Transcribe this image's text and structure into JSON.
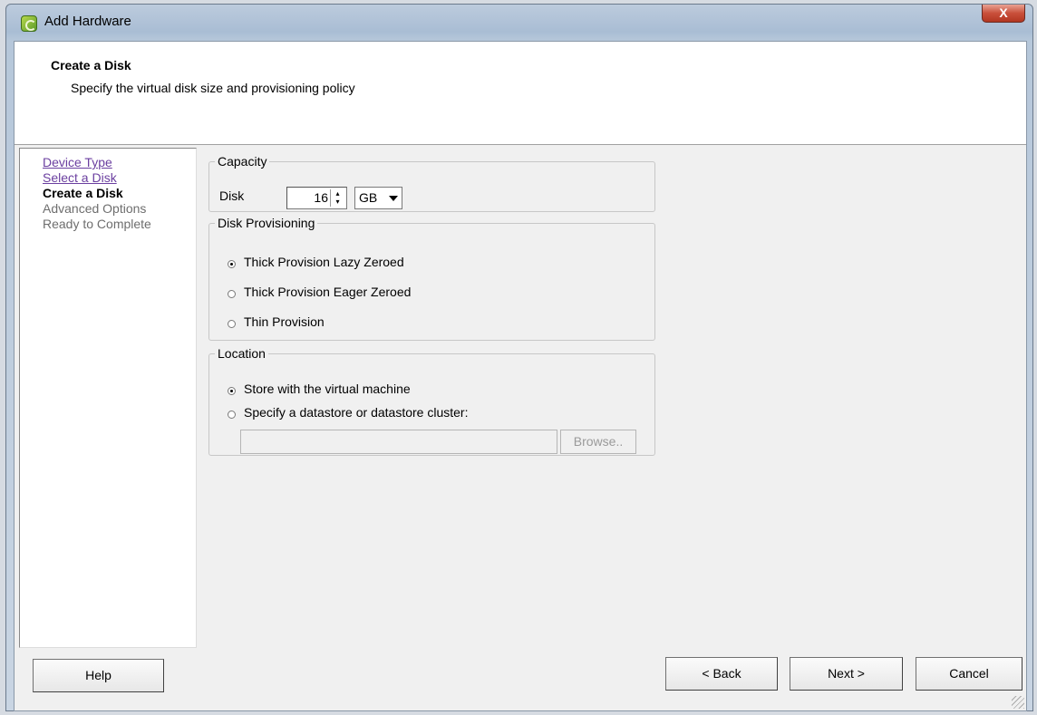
{
  "window": {
    "title": "Add Hardware",
    "close_label": "X"
  },
  "header": {
    "title": "Create a Disk",
    "subtitle": "Specify the virtual disk size and provisioning policy"
  },
  "steps": [
    {
      "label": "Device Type",
      "state": "completed-link"
    },
    {
      "label": "Select a Disk",
      "state": "completed-link"
    },
    {
      "label": "Create a Disk",
      "state": "current"
    },
    {
      "label": "Advanced Options",
      "state": "future"
    },
    {
      "label": "Ready to Complete",
      "state": "future"
    }
  ],
  "capacity": {
    "legend": "Capacity",
    "disk_label": "Disk",
    "disk_value": "16",
    "unit_selected": "GB"
  },
  "provisioning": {
    "legend": "Disk Provisioning",
    "options": [
      {
        "label": "Thick Provision Lazy Zeroed",
        "selected": true
      },
      {
        "label": "Thick Provision Eager Zeroed",
        "selected": false
      },
      {
        "label": "Thin Provision",
        "selected": false
      }
    ]
  },
  "location": {
    "legend": "Location",
    "options": [
      {
        "label": "Store with the virtual machine",
        "selected": true
      },
      {
        "label": "Specify a datastore or datastore cluster:",
        "selected": false
      }
    ],
    "datastore_value": "",
    "browse_label": "Browse.."
  },
  "buttons": {
    "help": "Help",
    "back": "< Back",
    "next": "Next >",
    "cancel": "Cancel"
  }
}
